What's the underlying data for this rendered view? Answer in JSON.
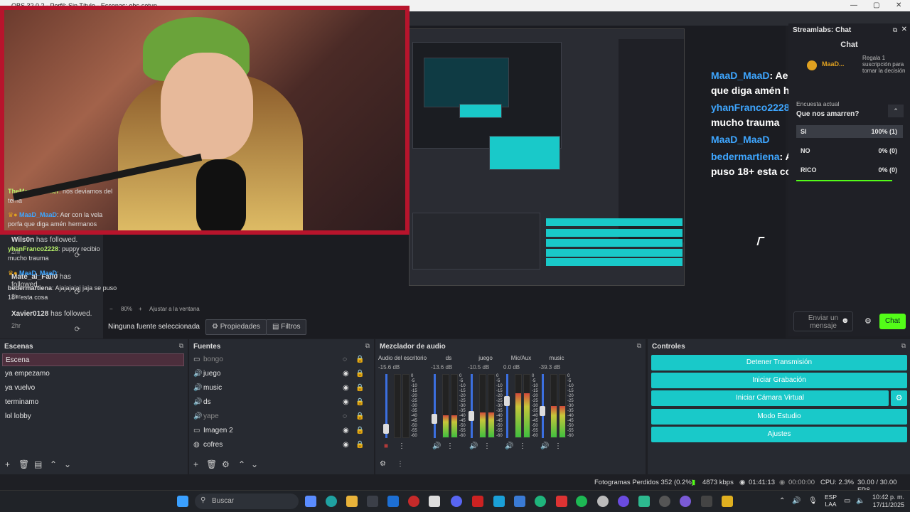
{
  "window": {
    "title": "OBS 32.0.2 - Perfil: Sin Título - Escenas: obs-setup"
  },
  "overlay_chat": [
    {
      "user": "MaaD_MaaD",
      "text": ": Aer con la vela porfa que diga amén hermanos"
    },
    {
      "user": "yhanFranco2228",
      "text": ": puppy recibio mucho trauma"
    },
    {
      "user": "MaaD_MaaD",
      "text": ""
    },
    {
      "user": "bedermartiena",
      "text": ": Ajajajajaj jaja se puso 18+ esta cosa"
    }
  ],
  "follows": [
    {
      "name": "Wils0n",
      "action": "has followed.",
      "time": "2hr"
    },
    {
      "name": "Mate_al_Fall0",
      "action": "has followed.",
      "time": "2hr"
    },
    {
      "name": "Xavier0128",
      "action": "has followed.",
      "time": "2hr"
    }
  ],
  "zoom": {
    "value": "80%",
    "fit": "Ajustar a la ventana"
  },
  "propbar": {
    "nosource": "Ninguna fuente seleccionada",
    "properties": "Propiedades",
    "filters": "Filtros"
  },
  "streamlabs": {
    "title": "Streamlabs: Chat",
    "subtitle": "Chat",
    "pinned_user": "MaaD...",
    "pinned_note": "Regala 1 suscripción para tomar la decisión",
    "poll_label": "Encuesta actual",
    "poll_question": "Que nos amarren?",
    "poll": [
      {
        "option": "SI",
        "result": "100% (1)"
      },
      {
        "option": "NO",
        "result": "0% (0)"
      },
      {
        "option": "RICO",
        "result": "0% (0)"
      }
    ],
    "messages": [
      {
        "user": "TheMaznaGamer",
        "text": ": nos deviamos del tema"
      },
      {
        "user": "MaaD_MaaD",
        "text": ": Aer con la vela porfa que diga amén hermanos"
      },
      {
        "user": "yhanFranco2228",
        "text": ": puppy recibio mucho trauma"
      },
      {
        "user": "MaaD_MaaD",
        "text": ":"
      },
      {
        "user": "bedermartiena",
        "text": ": Ajajajajaj jaja se puso 18+ esta cosa"
      }
    ],
    "send_placeholder": "Enviar un mensaje",
    "chat_button": "Chat"
  },
  "scenes": {
    "title": "Escenas",
    "items": [
      "Escena",
      "ya empezamo",
      "ya vuelvo",
      "terminamo",
      "lol lobby"
    ]
  },
  "sources": {
    "title": "Fuentes",
    "items": [
      "bongo",
      "juego",
      "music",
      "ds",
      "yape",
      "Imagen 2",
      "cofres"
    ]
  },
  "mixer": {
    "title": "Mezclador de audio",
    "channels": [
      {
        "name": "Audio del escritorio",
        "db": "-15.6 dB",
        "level": 0.0
      },
      {
        "name": "ds",
        "db": "-13.6 dB",
        "level": 0.35
      },
      {
        "name": "juego",
        "db": "-10.5 dB",
        "level": 0.4
      },
      {
        "name": "Mic/Aux",
        "db": "0.0 dB",
        "level": 0.7
      },
      {
        "name": "music",
        "db": "-39.3 dB",
        "level": 0.5
      }
    ],
    "scale": [
      "0",
      "-5",
      "-10",
      "-15",
      "-20",
      "-25",
      "-30",
      "-35",
      "-40",
      "-45",
      "-50",
      "-55",
      "-60"
    ]
  },
  "controls": {
    "title": "Controles",
    "buttons": [
      "Detener Transmisión",
      "Iniciar Grabación",
      "Iniciar Cámara Virtual",
      "Modo Estudio",
      "Ajustes"
    ]
  },
  "status": {
    "dropped": "Fotogramas Perdidos 352 (0.2%)",
    "bitrate": "4873 kbps",
    "live_time": "01:41:13",
    "rec_time": "00:00:00",
    "cpu": "CPU: 2.3%",
    "fps": "30.00 / 30.00 FPS"
  },
  "taskbar": {
    "search": "Buscar",
    "lang": "ESP",
    "lang2": "LAA",
    "time": "10:42 p. m.",
    "date": "17/11/2025"
  },
  "colors": {
    "accent": "#19c9c9",
    "chat_button": "#53fc18",
    "scene_selected": "#4c2e3c"
  }
}
